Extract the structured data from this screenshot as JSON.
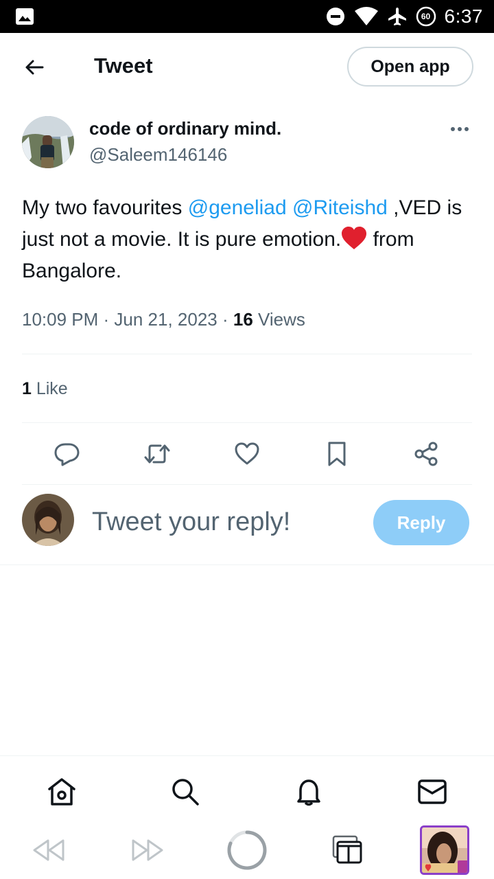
{
  "status_bar": {
    "time": "6:37",
    "battery_level": "60",
    "icons": [
      "gallery-icon",
      "dnd-icon",
      "wifi-icon",
      "airplane-icon",
      "battery-icon"
    ]
  },
  "header": {
    "title": "Tweet",
    "open_app_label": "Open app",
    "back_icon": "arrow-left-icon"
  },
  "tweet": {
    "author_name": "code of ordinary mind.",
    "author_handle": "@Saleem146146",
    "text_part1": "My two favourites ",
    "mention1": "@geneliad",
    "text_space": " ",
    "mention2": "@Riteishd",
    "text_part2": " ,VED is just not a movie. It is pure emotion.",
    "text_part3": " from Bangalore.",
    "time": "10:09 PM",
    "date": "Jun 21, 2023",
    "views_count": "16",
    "views_label": " Views",
    "likes_count": "1",
    "likes_label": " Like",
    "separator": " · "
  },
  "actions": [
    "reply-icon",
    "retweet-icon",
    "like-icon",
    "bookmark-icon",
    "share-icon"
  ],
  "composer": {
    "placeholder": "Tweet your reply!",
    "reply_label": "Reply"
  },
  "bottom_nav": [
    "home-icon",
    "search-icon",
    "notifications-icon",
    "messages-icon"
  ],
  "browser_bar": [
    "rewind-icon",
    "fast-forward-icon",
    "loading-icon",
    "tabs-icon",
    "thumbnail"
  ],
  "colors": {
    "accent": "#1d9bf0",
    "reply_button": "#8ecdf8",
    "secondary_text": "#536471",
    "heart": "#f91880"
  }
}
